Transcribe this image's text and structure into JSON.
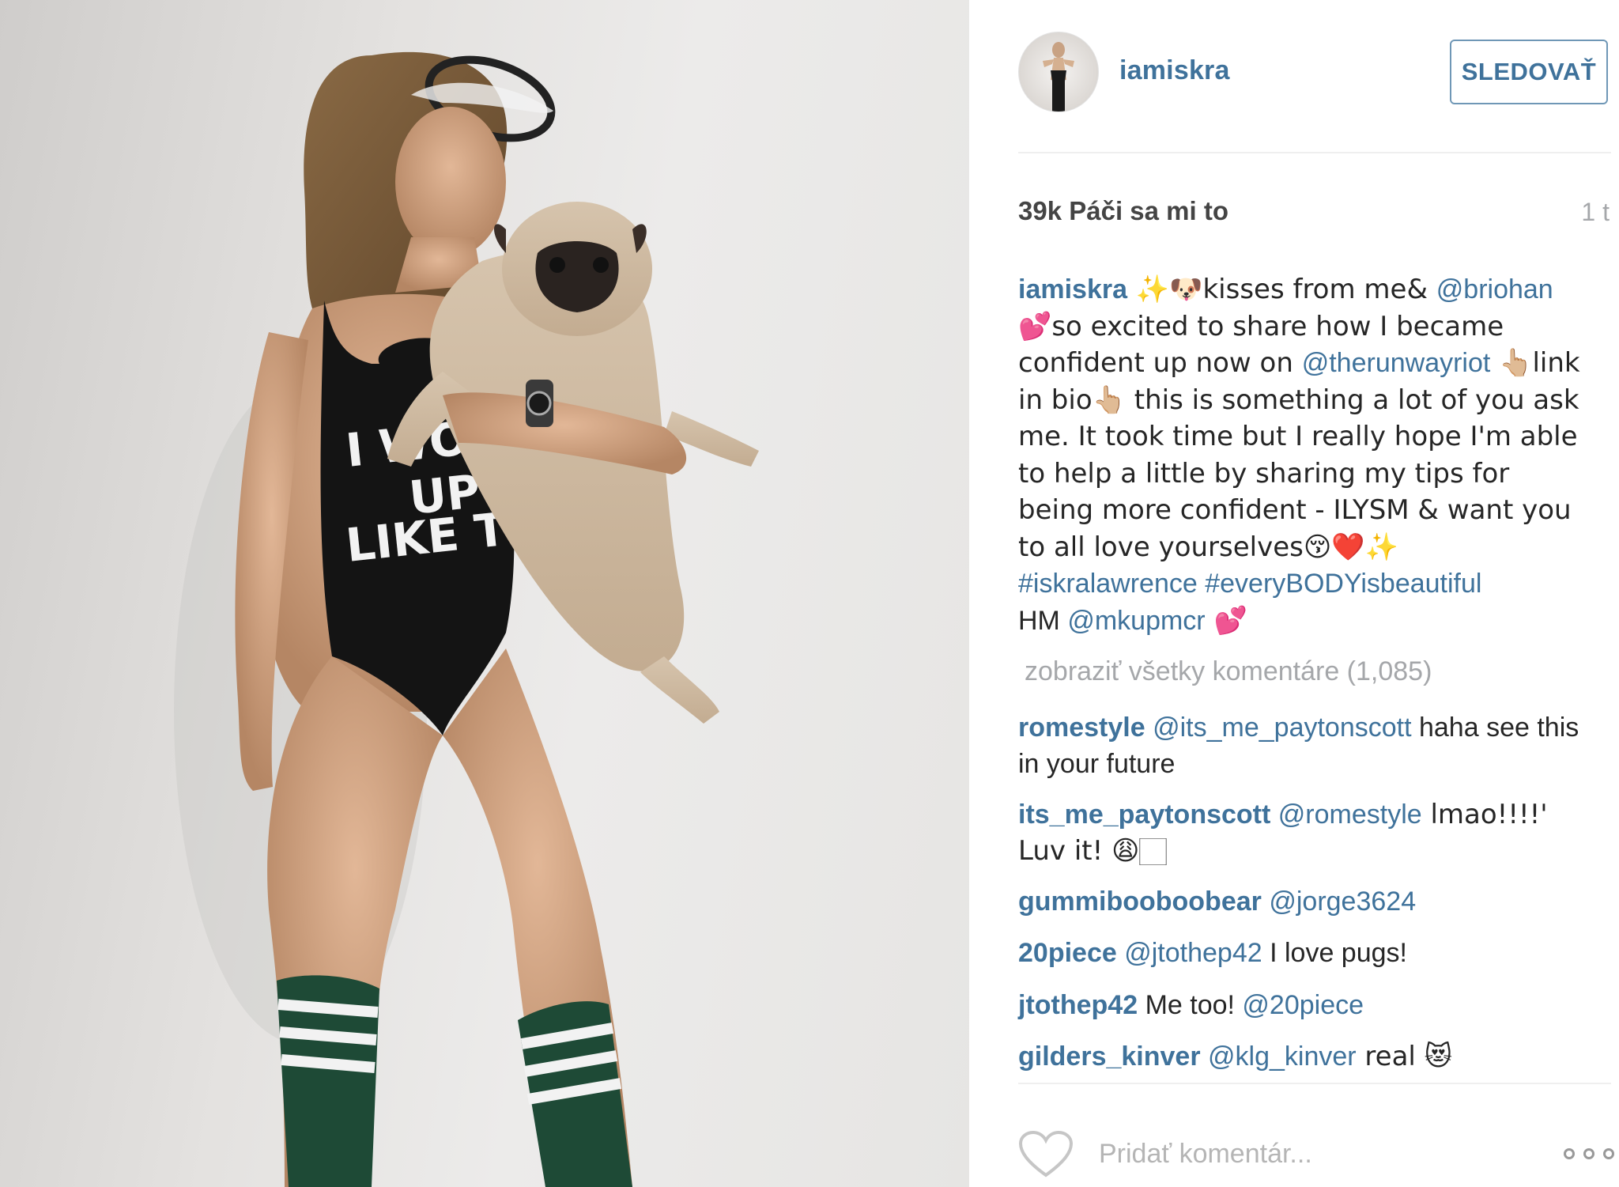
{
  "post": {
    "username": "iamiskra",
    "follow_label": "SLEDOVAŤ",
    "likes_text": "39k Páči sa mi to",
    "time": "1 t",
    "caption": {
      "user": "iamiskra",
      "text1": " ✨🐶kisses from me& ",
      "mention1": "@briohan",
      "text2": "💕so excited to share how I became confident up now on ",
      "mention2": "@therunwayriot",
      "text3": " 👆🏼link in bio👆🏼 this is something a lot of you ask me. It took time but I really hope I'm able to help a little by sharing my tips for being more confident - ILYSM & want you to all love yourselves😚❤️✨ ",
      "tag1": "#iskralawrence",
      "tag2": "#everyBODYisbeautiful",
      "text4": "HM ",
      "mention3": "@mkupmcr",
      "text5": " 💕"
    },
    "view_all_comments": "zobraziť všetky komentáre (1,085)",
    "comments": [
      {
        "user": "romestyle",
        "mention": "@its_me_paytonscott",
        "text": " haha see this in your future"
      },
      {
        "user": "its_me_paytonscott",
        "mention": "@romestyle",
        "text": " lmao!!!!' Luv it! 😩🏻"
      },
      {
        "user": "gummibooboobear",
        "mention": "@jorge3624",
        "text": ""
      },
      {
        "user": "20piece",
        "mention": "@jtothep42",
        "text": " I love pugs!"
      },
      {
        "user": "jtothep42",
        "mention": "@20piece",
        "pre_text": " Me too! ",
        "text": ""
      },
      {
        "user": "gilders_kinver",
        "mention": "@klg_kinver",
        "text": " real 😻"
      }
    ],
    "add_comment_placeholder": "Pridať komentár..."
  },
  "photo": {
    "shirt_text_line1": "I WOKE",
    "shirt_text_line2": "UP",
    "shirt_text_line3": "LIKE THIS"
  },
  "icons": {
    "heart": "heart-outline-icon",
    "more": "more-dots-icon"
  },
  "colors": {
    "link_blue": "#3f729b",
    "muted_gray": "#a5a7aa",
    "text_dark": "#262626"
  }
}
